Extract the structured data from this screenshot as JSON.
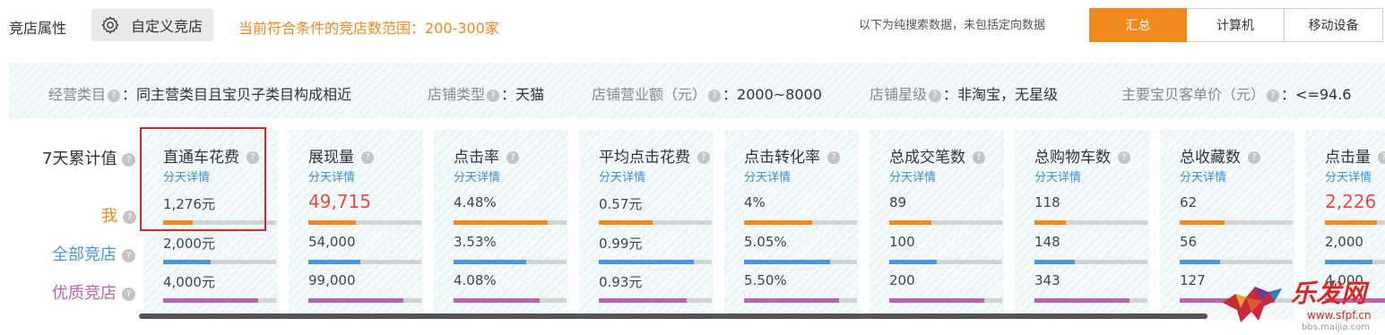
{
  "toolbar": {
    "attr_label": "竞店属性",
    "custom_button": "自定义竞店",
    "range_text": "当前符合条件的竞店数范围：200-300家",
    "note": "以下为纯搜索数据，未包括定向数据",
    "tabs": [
      {
        "label": "汇总",
        "active": true
      },
      {
        "label": "计算机",
        "active": false
      },
      {
        "label": "移动设备",
        "active": false
      }
    ]
  },
  "filters": [
    {
      "key": "经营类目",
      "value": "同主营类目且宝贝子类目构成相近"
    },
    {
      "key": "店铺类型",
      "value": "天猫"
    },
    {
      "key": "店铺营业额（元）",
      "value": "2000~8000"
    },
    {
      "key": "店铺星级",
      "value": "非淘宝，无星级"
    },
    {
      "key": "主要宝贝客单价（元）",
      "value": "<=94.6"
    }
  ],
  "row_labels": {
    "period": "7天累计值",
    "me": "我",
    "all": "全部竞店",
    "quality": "优质竞店"
  },
  "colors": {
    "accent": "#f08a1f",
    "all": "#4b98d6",
    "quality": "#b766b0",
    "me_label": "#f08a1f",
    "highlight": "#d7262b"
  },
  "detail_label": "分天详情",
  "metrics": [
    {
      "title": "直通车花费",
      "me": "1,276元",
      "me_big": false,
      "all": "2,000元",
      "quality": "4,000元",
      "bars": [
        0.26,
        0.42,
        0.84
      ]
    },
    {
      "title": "展现量",
      "me": "49,715",
      "me_big": true,
      "all": "54,000",
      "quality": "99,000",
      "bars": [
        0.42,
        0.46,
        0.84
      ]
    },
    {
      "title": "点击率",
      "me": "4.48%",
      "me_big": false,
      "all": "3.53%",
      "quality": "4.08%",
      "bars": [
        0.83,
        0.64,
        0.76
      ]
    },
    {
      "title": "平均点击花费",
      "me": "0.57元",
      "me_big": false,
      "all": "0.99元",
      "quality": "0.93元",
      "bars": [
        0.48,
        0.84,
        0.78
      ]
    },
    {
      "title": "点击转化率",
      "me": "4%",
      "me_big": false,
      "all": "5.05%",
      "quality": "5.50%",
      "bars": [
        0.6,
        0.76,
        0.84
      ]
    },
    {
      "title": "总成交笔数",
      "me": "89",
      "me_big": false,
      "all": "100",
      "quality": "200",
      "bars": [
        0.37,
        0.42,
        0.84
      ]
    },
    {
      "title": "总购物车数",
      "me": "118",
      "me_big": false,
      "all": "148",
      "quality": "343",
      "bars": [
        0.28,
        0.36,
        0.84
      ]
    },
    {
      "title": "总收藏数",
      "me": "62",
      "me_big": false,
      "all": "56",
      "quality": "127",
      "bars": [
        0.4,
        0.36,
        0.84
      ]
    },
    {
      "title": "点击量",
      "me": "2,226",
      "me_big": true,
      "all": "2,000",
      "quality": "4,000",
      "bars": [
        0.46,
        0.42,
        0.84
      ]
    }
  ],
  "watermark": {
    "brand": "乐发网",
    "url": "www.sfpf.cn",
    "url2": "bbs.maijia.com"
  }
}
